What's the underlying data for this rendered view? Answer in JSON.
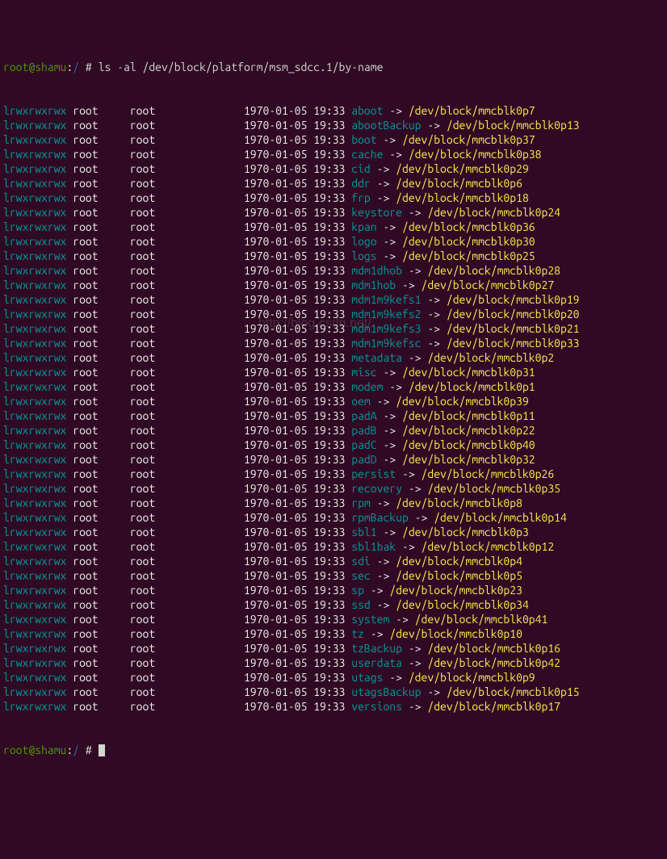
{
  "prompt": {
    "userhost": "root@shamu",
    "sep1": ":",
    "path": "/",
    "sep2": " # ",
    "command": "ls -al /dev/block/platform/msm_sdcc.1/by-name"
  },
  "cols": {
    "perms": "lrwxrwxrwx",
    "owner": "root",
    "group": "root",
    "date": "1970-01-05 19:33",
    "arrow": "->"
  },
  "entries": [
    {
      "name": "aboot",
      "target": "/dev/block/mmcblk0p7"
    },
    {
      "name": "abootBackup",
      "target": "/dev/block/mmcblk0p13"
    },
    {
      "name": "boot",
      "target": "/dev/block/mmcblk0p37"
    },
    {
      "name": "cache",
      "target": "/dev/block/mmcblk0p38"
    },
    {
      "name": "cid",
      "target": "/dev/block/mmcblk0p29"
    },
    {
      "name": "ddr",
      "target": "/dev/block/mmcblk0p6"
    },
    {
      "name": "frp",
      "target": "/dev/block/mmcblk0p18"
    },
    {
      "name": "keystore",
      "target": "/dev/block/mmcblk0p24"
    },
    {
      "name": "kpan",
      "target": "/dev/block/mmcblk0p36"
    },
    {
      "name": "logo",
      "target": "/dev/block/mmcblk0p30"
    },
    {
      "name": "logs",
      "target": "/dev/block/mmcblk0p25"
    },
    {
      "name": "mdm1dhob",
      "target": "/dev/block/mmcblk0p28"
    },
    {
      "name": "mdm1hob",
      "target": "/dev/block/mmcblk0p27"
    },
    {
      "name": "mdm1m9kefs1",
      "target": "/dev/block/mmcblk0p19"
    },
    {
      "name": "mdm1m9kefs2",
      "target": "/dev/block/mmcblk0p20"
    },
    {
      "name": "mdm1m9kefs3",
      "target": "/dev/block/mmcblk0p21"
    },
    {
      "name": "mdm1m9kefsc",
      "target": "/dev/block/mmcblk0p33"
    },
    {
      "name": "metadata",
      "target": "/dev/block/mmcblk0p2"
    },
    {
      "name": "misc",
      "target": "/dev/block/mmcblk0p31"
    },
    {
      "name": "modem",
      "target": "/dev/block/mmcblk0p1"
    },
    {
      "name": "oem",
      "target": "/dev/block/mmcblk0p39"
    },
    {
      "name": "padA",
      "target": "/dev/block/mmcblk0p11"
    },
    {
      "name": "padB",
      "target": "/dev/block/mmcblk0p22"
    },
    {
      "name": "padC",
      "target": "/dev/block/mmcblk0p40"
    },
    {
      "name": "padD",
      "target": "/dev/block/mmcblk0p32"
    },
    {
      "name": "persist",
      "target": "/dev/block/mmcblk0p26"
    },
    {
      "name": "recovery",
      "target": "/dev/block/mmcblk0p35"
    },
    {
      "name": "rpm",
      "target": "/dev/block/mmcblk0p8"
    },
    {
      "name": "rpmBackup",
      "target": "/dev/block/mmcblk0p14"
    },
    {
      "name": "sbl1",
      "target": "/dev/block/mmcblk0p3"
    },
    {
      "name": "sbl1bak",
      "target": "/dev/block/mmcblk0p12"
    },
    {
      "name": "sdi",
      "target": "/dev/block/mmcblk0p4"
    },
    {
      "name": "sec",
      "target": "/dev/block/mmcblk0p5"
    },
    {
      "name": "sp",
      "target": "/dev/block/mmcblk0p23"
    },
    {
      "name": "ssd",
      "target": "/dev/block/mmcblk0p34"
    },
    {
      "name": "system",
      "target": "/dev/block/mmcblk0p41"
    },
    {
      "name": "tz",
      "target": "/dev/block/mmcblk0p10"
    },
    {
      "name": "tzBackup",
      "target": "/dev/block/mmcblk0p16"
    },
    {
      "name": "userdata",
      "target": "/dev/block/mmcblk0p42"
    },
    {
      "name": "utags",
      "target": "/dev/block/mmcblk0p9"
    },
    {
      "name": "utagsBackup",
      "target": "/dev/block/mmcblk0p15"
    },
    {
      "name": "versions",
      "target": "/dev/block/mmcblk0p17"
    }
  ],
  "watermark": "http://blog.csdn.net/"
}
